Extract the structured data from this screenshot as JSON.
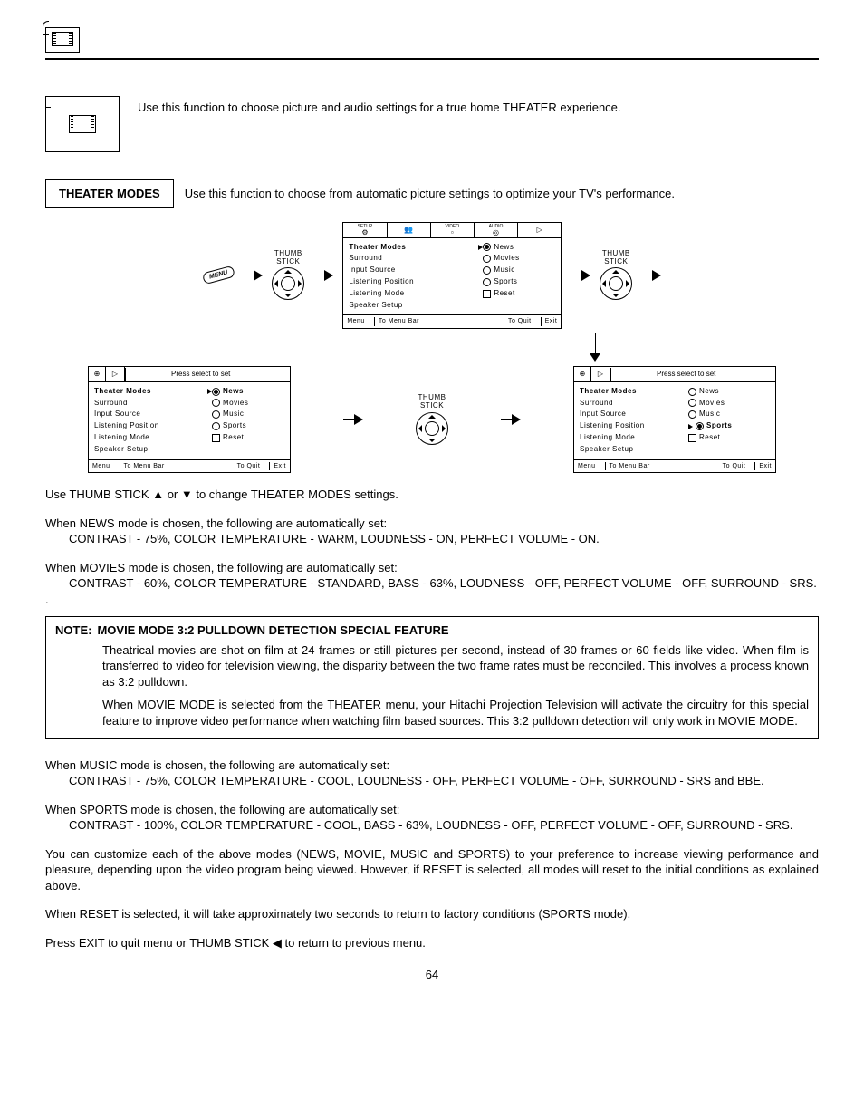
{
  "header_icon": "theater-film-icon",
  "intro_text": "Use this function to choose picture and audio settings for a true home THEATER experience.",
  "section": {
    "label": "THEATER MODES",
    "desc": "Use this function to choose from automatic picture settings to optimize your TV's performance."
  },
  "thumb_label_1": "THUMB",
  "thumb_label_2": "STICK",
  "menu_chip": "MENU",
  "osd_tabs": [
    {
      "name": "SETUP",
      "glyph": "⚙"
    },
    {
      "name": "",
      "glyph": "👥"
    },
    {
      "name": "VIDEO",
      "glyph": "▫"
    },
    {
      "name": "AUDIO",
      "glyph": "◎"
    },
    {
      "name": "",
      "glyph": "▷"
    }
  ],
  "osd_hint": "Press select to set",
  "osd_left_items": [
    "Theater Modes",
    "Surround",
    "Input Source",
    "Listening Position",
    "Listening Mode",
    "Speaker Setup"
  ],
  "osd_right_items": [
    "News",
    "Movies",
    "Music",
    "Sports",
    "Reset"
  ],
  "osd_footer": {
    "menu": "Menu",
    "tomenu": "To Menu Bar",
    "toquit": "To Quit",
    "exit": "Exit"
  },
  "panel_a_selected_left": "Theater Modes",
  "panel_a_selected_right": "News",
  "panel_b_pointer_right": "News",
  "panel_b_selected_right": "News",
  "panel_c_pointer_right": "Sports",
  "panel_c_selected_right": "Sports",
  "body": {
    "thumb_instr": "Use THUMB STICK ▲ or ▼ to change THEATER MODES settings.",
    "news1": "When NEWS mode is chosen, the following are automatically set:",
    "news2": "CONTRAST - 75%, COLOR TEMPERATURE - WARM, LOUDNESS - ON, PERFECT VOLUME - ON.",
    "movies1": "When MOVIES mode is chosen, the following are automatically set:",
    "movies2": "CONTRAST - 60%, COLOR TEMPERATURE - STANDARD, BASS - 63%, LOUDNESS - OFF, PERFECT VOLUME - OFF, SURROUND - SRS.",
    "dot": ".",
    "note_label": "NOTE:",
    "note_title": "MOVIE MODE 3:2 PULLDOWN DETECTION SPECIAL FEATURE",
    "note_p1": "Theatrical movies are shot on film at 24 frames or still pictures per second, instead of 30 frames or 60 fields like video.  When film is transferred to video for television viewing, the disparity between the two frame rates must be reconciled.  This involves a process known as 3:2 pulldown.",
    "note_p2": "When MOVIE MODE is selected from the THEATER menu, your Hitachi Projection Television will activate the circuitry for this special feature to improve video performance when watching film based sources.  This 3:2 pulldown detection will only work in MOVIE MODE.",
    "music1": "When MUSIC mode is chosen, the following are automatically set:",
    "music2": "CONTRAST - 75%, COLOR TEMPERATURE - COOL, LOUDNESS - OFF, PERFECT VOLUME - OFF, SURROUND - SRS and BBE.",
    "sports1": "When SPORTS mode is chosen, the following are automatically set:",
    "sports2": "CONTRAST - 100%, COLOR TEMPERATURE - COOL, BASS - 63%, LOUDNESS - OFF, PERFECT VOLUME - OFF, SURROUND - SRS.",
    "custom": "You can customize each of the above modes (NEWS, MOVIE, MUSIC and SPORTS) to your preference to increase viewing performance and pleasure, depending upon the video program being viewed. However, if RESET is selected, all modes will reset to the initial conditions as explained above.",
    "reset": "When RESET is selected, it will take approximately two seconds to return to factory conditions (SPORTS mode).",
    "exit": "Press EXIT to quit menu or THUMB STICK ◀ to return to previous menu."
  },
  "page_num": "64"
}
